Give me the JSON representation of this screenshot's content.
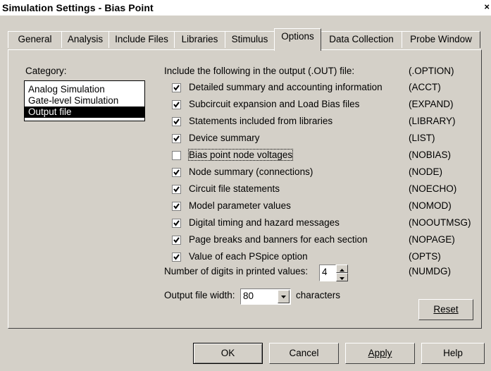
{
  "window": {
    "title": "Simulation Settings - Bias Point",
    "close_glyph": "×"
  },
  "tabs": [
    {
      "label": "General"
    },
    {
      "label": "Analysis"
    },
    {
      "label": "Include Files"
    },
    {
      "label": "Libraries"
    },
    {
      "label": "Stimulus"
    },
    {
      "label": "Options",
      "active": true
    },
    {
      "label": "Data Collection"
    },
    {
      "label": "Probe Window"
    }
  ],
  "category": {
    "label": "Category:",
    "items": [
      "Analog Simulation",
      "Gate-level Simulation",
      "Output file"
    ],
    "selected": "Output file"
  },
  "output": {
    "header": "Include the following in the output (.OUT) file:",
    "header_code": "(.OPTION)",
    "options": [
      {
        "label": "Detailed summary and accounting information",
        "code": "(ACCT)",
        "checked": true
      },
      {
        "label": "Subcircuit expansion and Load Bias files",
        "code": "(EXPAND)",
        "checked": true
      },
      {
        "label": "Statements included from libraries",
        "code": "(LIBRARY)",
        "checked": true
      },
      {
        "label": "Device summary",
        "code": "(LIST)",
        "checked": true
      },
      {
        "label": "Bias point node voltages",
        "code": "(NOBIAS)",
        "checked": false
      },
      {
        "label": "Node summary (connections)",
        "code": "(NODE)",
        "checked": true
      },
      {
        "label": "Circuit file statements",
        "code": "(NOECHO)",
        "checked": true
      },
      {
        "label": "Model parameter values",
        "code": "(NOMOD)",
        "checked": true
      },
      {
        "label": "Digital timing and hazard messages",
        "code": "(NOOUTMSG)",
        "checked": true
      },
      {
        "label": "Page breaks and banners for each section",
        "code": "(NOPAGE)",
        "checked": true
      },
      {
        "label": "Value of each PSpice option",
        "code": "(OPTS)",
        "checked": true
      }
    ],
    "digits_label": "Number of digits in printed values:",
    "digits_value": "4",
    "digits_code": "(NUMDG)",
    "width_label": "Output file width:",
    "width_value": "80",
    "width_suffix": "characters",
    "reset_label": "Reset"
  },
  "buttons": {
    "ok": "OK",
    "cancel": "Cancel",
    "apply": "Apply",
    "help": "Help"
  }
}
